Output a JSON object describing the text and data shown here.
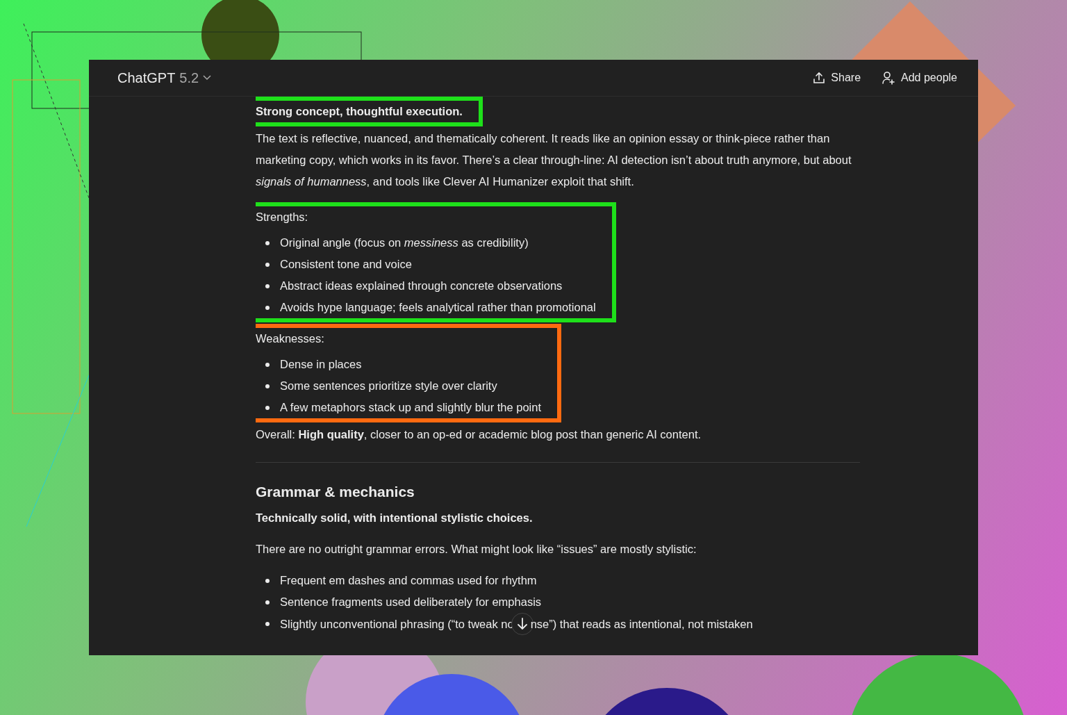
{
  "header": {
    "title": "ChatGPT",
    "version": "5.2",
    "actions": [
      {
        "kind": "share",
        "label": "Share"
      },
      {
        "kind": "add_people",
        "label": "Add people"
      }
    ]
  },
  "content": [
    {
      "kind": "highlight",
      "color": "#1ee01a",
      "blocks": [
        {
          "kind": "bold",
          "text": "Strong concept, thoughtful execution."
        }
      ]
    },
    {
      "kind": "paragraph",
      "text": "The text is reflective, nuanced, and thematically coherent. It reads like an opinion essay or think-piece rather than marketing copy, which works in its favor. There’s a clear through-line: AI detection isn’t about truth anymore, but about *signals of humanness*, and tools like Clever AI Humanizer exploit that shift."
    },
    {
      "kind": "highlight",
      "color": "#1ee01a",
      "blocks": [
        {
          "kind": "paragraph",
          "text": "Strengths:"
        },
        {
          "kind": "list",
          "items": [
            {
              "parts": [
                "Original angle (focus on *messiness* as credibility)"
              ]
            },
            {
              "parts": [
                "Consistent tone and voice"
              ]
            },
            {
              "parts": [
                "Abstract ideas explained through concrete observations"
              ]
            },
            {
              "parts": [
                "Avoids hype language; feels analytical rather than promotional"
              ]
            }
          ]
        }
      ]
    },
    {
      "kind": "highlight",
      "color": "#ff6a10",
      "blocks": [
        {
          "kind": "paragraph",
          "text": "Weaknesses:"
        },
        {
          "kind": "list",
          "items": [
            {
              "parts": [
                "Dense in places"
              ]
            },
            {
              "parts": [
                "Some sentences prioritize style over clarity"
              ]
            },
            {
              "parts": [
                "A few metaphors stack up and slightly blur the point"
              ]
            }
          ]
        }
      ]
    },
    {
      "kind": "paragraph",
      "text": "Overall: **High quality**, closer to an op-ed or academic blog post than generic AI content."
    },
    {
      "kind": "rule"
    },
    {
      "kind": "heading",
      "text": "Grammar & mechanics"
    },
    {
      "kind": "bold",
      "text": "Technically solid, with intentional stylistic choices."
    },
    {
      "kind": "paragraph",
      "text": "There are no outright grammar errors. What might look like “issues” are mostly stylistic:"
    },
    {
      "kind": "list",
      "items": [
        {
          "parts": [
            "Frequent em dashes and commas used for rhythm"
          ]
        },
        {
          "parts": [
            "Sentence fragments used deliberately for emphasis"
          ]
        },
        {
          "parts": [
            "Slightly unconventional phrasing (“to tweak no",
            "nse”) that reads as intentional, not mistaken"
          ]
        }
      ]
    }
  ]
}
